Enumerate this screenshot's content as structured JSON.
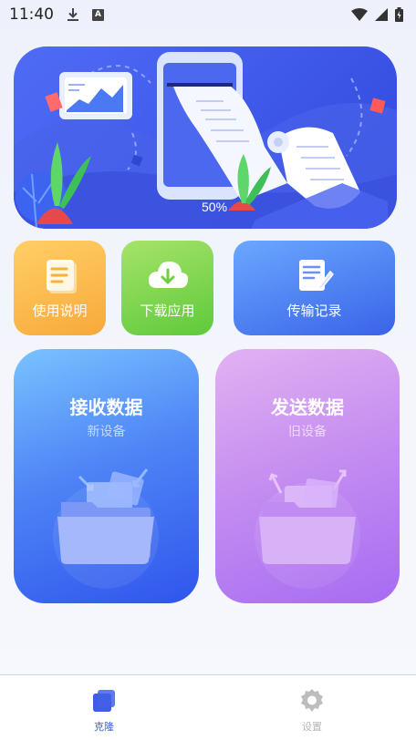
{
  "status_bar": {
    "time": "11:40",
    "download_icon": "download-icon",
    "a_badge": "A",
    "wifi_icon": "wifi-icon",
    "signal_icon": "signal-icon",
    "battery_icon": "battery-icon"
  },
  "banner": {
    "percent": "50%",
    "illustration": "phone-transfer-illustration"
  },
  "tiles": {
    "guide": {
      "label": "使用说明",
      "icon": "document-icon"
    },
    "download": {
      "label": "下载应用",
      "icon": "cloud-download-icon"
    },
    "transfer": {
      "label": "传输记录",
      "icon": "notepad-edit-icon"
    }
  },
  "cards": {
    "receive": {
      "title": "接收数据",
      "subtitle": "新设备",
      "icon": "folder-receive-icon"
    },
    "send": {
      "title": "发送数据",
      "subtitle": "旧设备",
      "icon": "folder-send-icon"
    }
  },
  "bottom_nav": {
    "clone": {
      "label": "克隆",
      "icon": "clone-icon",
      "color": "#3e5ce6"
    },
    "settings": {
      "label": "设置",
      "icon": "gear-icon",
      "color": "#b7b7b7"
    }
  }
}
